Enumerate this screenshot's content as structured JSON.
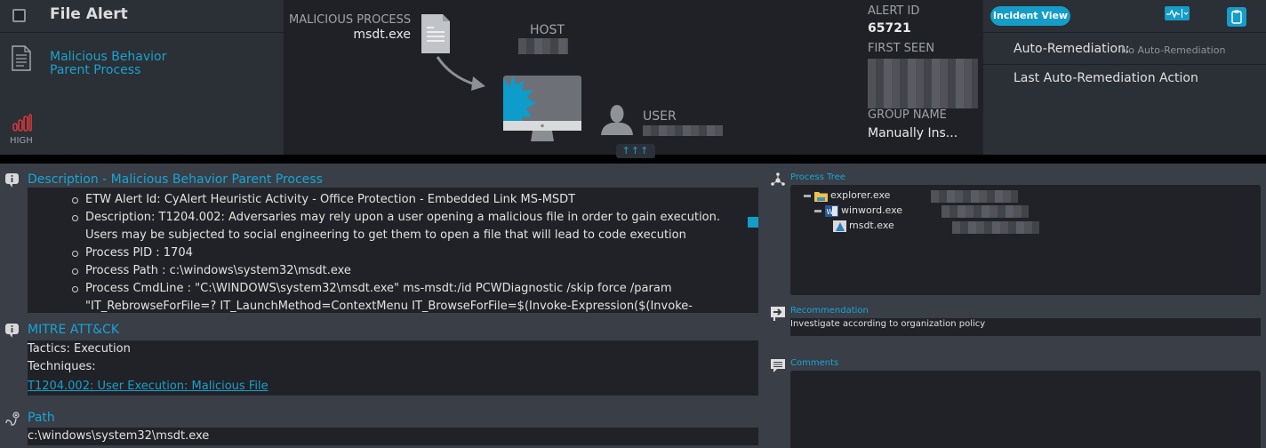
{
  "header": {
    "alert_type": "File Alert",
    "alert_name": "Malicious Behavior Parent Process",
    "severity": "HIGH",
    "severity_color": "#d63a3a",
    "malicious_process_label": "MALICIOUS PROCESS",
    "malicious_process_value": "msdt.exe",
    "host_label": "HOST",
    "user_label": "USER",
    "expand_label": "↑↑↑",
    "alert_id_label": "ALERT ID",
    "alert_id_value": "65721",
    "first_seen_label": "FIRST SEEN",
    "group_name_label": "GROUP NAME",
    "group_name_value": "Manually Ins..."
  },
  "actions": {
    "incident_view": "Incident View",
    "pulse_icon": "activity-dropdown-icon",
    "clipboard_icon": "clipboard-icon",
    "auto_remediation_label": "Auto-Remediation:",
    "auto_remediation_value": "No Auto-Remediation",
    "last_action_label": "Last Auto-Remediation Action"
  },
  "description": {
    "title": "Description - Malicious Behavior Parent Process",
    "items": [
      "ETW Alert Id: CyAlert Heuristic Activity - Office Protection - Embedded Link MS-MSDT",
      "Description: T1204.002: Adversaries may rely upon a user opening a malicious file in order to gain execution. Users may be subjected to social engineering to get them to open a file that will lead to code execution",
      "Process PID : 1704",
      "Process Path : c:\\windows\\system32\\msdt.exe",
      "Process CmdLine : \"C:\\WINDOWS\\system32\\msdt.exe\" ms-msdt:/id PCWDiagnostic /skip force /param \"IT_RebrowseForFile=? IT_LaunchMethod=ContextMenu IT_BrowseForFile=$(Invoke-Expression($(Invoke-"
    ]
  },
  "mitre": {
    "title": "MITRE ATT&CK",
    "tactics": "Tactics: Execution",
    "techniques_label": "Techniques:",
    "technique_link": "T1204.002: User Execution: Malicious File"
  },
  "path": {
    "title": "Path",
    "value": "c:\\windows\\system32\\msdt.exe"
  },
  "process_tree": {
    "title": "Process Tree",
    "nodes": [
      {
        "name": "explorer.exe",
        "icon": "folder-icon",
        "level": 0
      },
      {
        "name": "winword.exe",
        "icon": "word-icon",
        "level": 1
      },
      {
        "name": "msdt.exe",
        "icon": "msdt-icon",
        "level": 2
      }
    ]
  },
  "recommendation": {
    "title": "Recommendation",
    "value": "Investigate according to organization policy"
  },
  "comments": {
    "title": "Comments",
    "value": ""
  },
  "colors": {
    "accent": "#159cc7",
    "link": "#1a9fcc",
    "panel": "#2b2f36",
    "body_bg": "#393e47",
    "box_bg": "#202227"
  }
}
